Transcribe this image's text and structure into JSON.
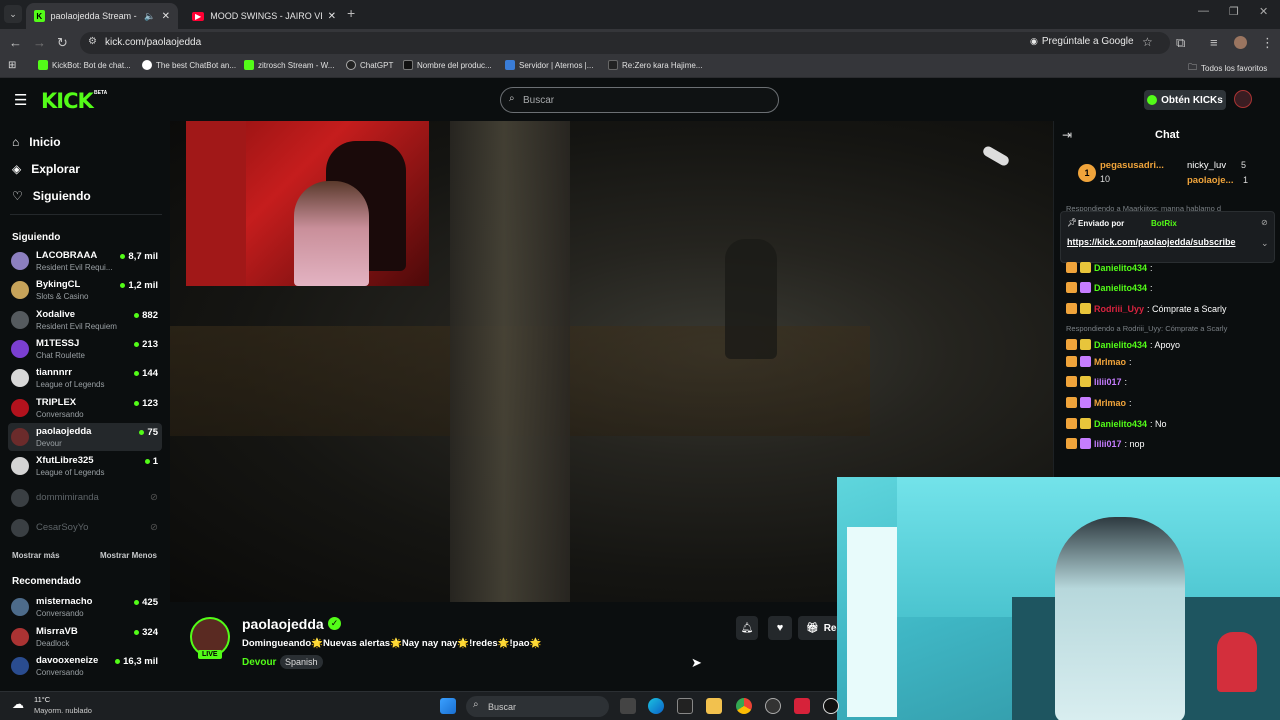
{
  "browser": {
    "tabs": [
      {
        "title": "paolaojedda Stream - Wat..."
      },
      {
        "title": "MOOD SWINGS - JAIRO VERA..."
      }
    ],
    "url": "kick.com/paolaojedda",
    "ask_google": "Pregúntale a Google",
    "bookmarks": [
      "KickBot: Bot de chat...",
      "The best ChatBot an...",
      "zitrosch Stream - W...",
      "ChatGPT",
      "Nombre del produc...",
      "Servidor | Aternos |...",
      "Re:Zero kara Hajime..."
    ],
    "all_favorites": "Todos los favoritos"
  },
  "header": {
    "logo": "KICK",
    "logo_beta": "BETA",
    "search_placeholder": "Buscar",
    "kicks_button": "Obtén KICKs"
  },
  "sidebar": {
    "nav": [
      {
        "label": "Inicio",
        "icon": "home-icon"
      },
      {
        "label": "Explorar",
        "icon": "compass-icon"
      },
      {
        "label": "Siguiendo",
        "icon": "heart-icon"
      }
    ],
    "following_title": "Siguiendo",
    "following": [
      {
        "name": "LACOBRAAA",
        "game": "Resident Evil Requi...",
        "viewers": "8,7 mil",
        "color": "#8c7fbf"
      },
      {
        "name": "BykingCL",
        "game": "Slots & Casino",
        "viewers": "1,2 mil",
        "color": "#c7a35a"
      },
      {
        "name": "Xodalive",
        "game": "Resident Evil Requiem",
        "viewers": "882",
        "color": "#555a5e"
      },
      {
        "name": "M1TESSJ",
        "game": "Chat Roulette",
        "viewers": "213",
        "color": "#7b3fd1"
      },
      {
        "name": "tiannnrr",
        "game": "League of Legends",
        "viewers": "144",
        "color": "#d8d8d8"
      },
      {
        "name": "TRIPLEX",
        "game": "Conversando",
        "viewers": "123",
        "color": "#b3121d"
      },
      {
        "name": "paolaojedda",
        "game": "Devour",
        "viewers": "75",
        "color": "#6b2b2b"
      },
      {
        "name": "XfutLibre325",
        "game": "League of Legends",
        "viewers": "1",
        "color": "#d4d4d4"
      }
    ],
    "offline": [
      "dommimiranda",
      "CesarSoyYo"
    ],
    "show_more": "Mostrar más",
    "show_less": "Mostrar Menos",
    "recommended_title": "Recomendado",
    "recommended": [
      {
        "name": "misternacho",
        "game": "Conversando",
        "viewers": "425",
        "color": "#4d6b8a"
      },
      {
        "name": "MisrraVB",
        "game": "Deadlock",
        "viewers": "324",
        "color": "#a33"
      },
      {
        "name": "davooxeneize",
        "game": "Conversando",
        "viewers": "16,3 mil",
        "color": "#2a4c8f"
      }
    ]
  },
  "stream": {
    "username": "paolaojedda",
    "title": "Domingueando🌟Nuevas alertas🌟Nay nay nay🌟!redes🌟!pao🌟",
    "live_badge": "LIVE",
    "category": "Devour",
    "tag": "Spanish",
    "gift_label": "Reg"
  },
  "chat": {
    "title": "Chat",
    "top_gifters": [
      {
        "rank": "1",
        "name": "pegasusadri...",
        "count": "10"
      },
      {
        "name": "nicky_luv",
        "count": "5"
      },
      {
        "name": "paolaoje...",
        "count": "1"
      }
    ],
    "reply_hint_1": "Respondiendo a Maarkiitos: manna hablamo d",
    "pinned_by_label": "Enviado por",
    "pinned_by": "BotRix",
    "pinned_link": "https://kick.com/paolaojedda/subscribe",
    "messages": [
      {
        "user": "Danielito434",
        "text": ":",
        "color": "#53fc18"
      },
      {
        "user": "Danielito434",
        "text": ":",
        "color": "#53fc18"
      },
      {
        "user": "Rodriii_Uyy",
        "text": ": Cómprate a Scarly",
        "color": "#d9233f"
      },
      {
        "reply": "Respondiendo a Rodriii_Uyy: Cómprate a Scarly"
      },
      {
        "user": "Danielito434",
        "text": ": Apoyo",
        "color": "#53fc18"
      },
      {
        "user": "MrImao",
        "text": ":",
        "color": "#f0a43b"
      },
      {
        "user": "lilii017",
        "text": ":",
        "color": "#c67dff"
      },
      {
        "user": "MrImao",
        "text": ":",
        "color": "#f0a43b"
      },
      {
        "user": "Danielito434",
        "text": ": No",
        "color": "#53fc18"
      },
      {
        "user": "lilii017",
        "text": ": nop",
        "color": "#c67dff"
      }
    ]
  },
  "taskbar": {
    "weather_temp": "11°C",
    "weather_desc": "Mayorm. nublado",
    "search": "Buscar"
  }
}
